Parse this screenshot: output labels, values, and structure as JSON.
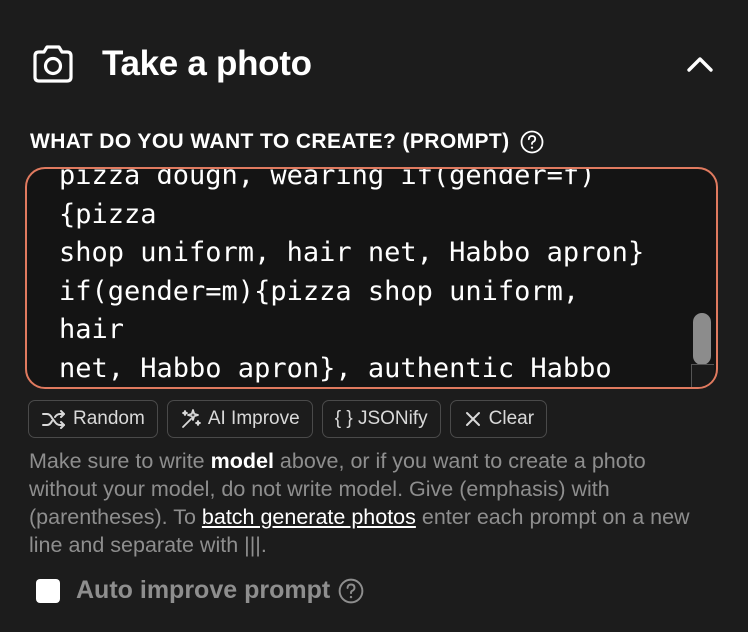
{
  "header": {
    "title": "Take a photo",
    "icon": "camera-icon",
    "collapse_icon": "chevron-up-icon"
  },
  "prompt": {
    "label": "WHAT DO YOU WANT TO CREATE? (PROMPT)",
    "value": "pizza dough, wearing if(gender=f){pizza\nshop uniform, hair net, Habbo apron}\nif(gender=m){pizza shop uniform, hair\nnet, Habbo apron}, authentic Habbo\npizzeria with brick ovens and Italian\ndecor'",
    "help_icon": "question-circle-icon",
    "border_color": "#e07a5f"
  },
  "buttons": {
    "random": "Random",
    "ai_improve": "AI Improve",
    "jsonify": "{ } JSONify",
    "clear": "Clear"
  },
  "hint": {
    "part1": "Make sure to write ",
    "bold": "model",
    "part2": " above, or if you want to create a photo without your model, do not write model. Give (emphasis) with (parentheses). To ",
    "link": "batch generate photos",
    "part3": " enter each prompt on a new line and separate with |||."
  },
  "auto_improve": {
    "label": "Auto improve prompt",
    "checked": false
  }
}
